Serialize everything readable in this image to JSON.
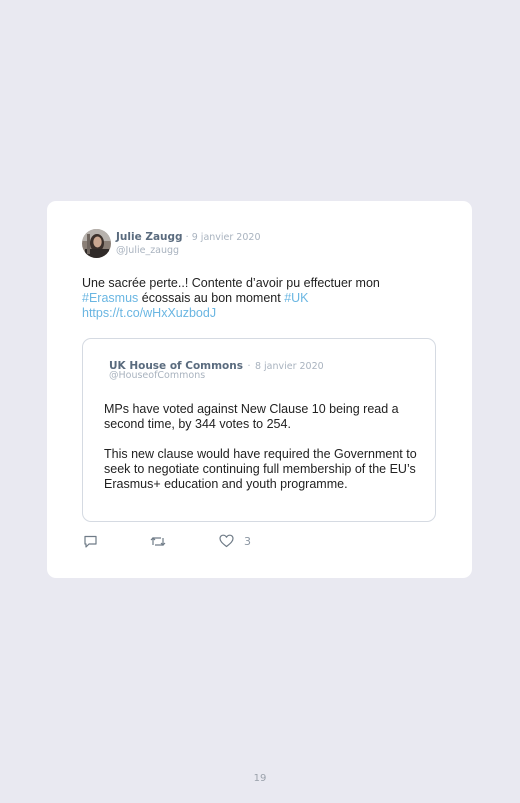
{
  "tweet": {
    "author_name": "Julie Zaugg",
    "separator": "·",
    "date": "9 janvier 2020",
    "handle": "@Julie_zaugg",
    "text_part1": "Une sacrée perte..! Contente d’avoir pu effectuer mon ",
    "hashtag1": "#Erasmus",
    "text_part2": " écossais au bon moment ",
    "hashtag2": "#UK",
    "url": "https://t.co/wHxXuzbodJ"
  },
  "quoted_tweet": {
    "author_name": "UK House of Commons",
    "separator": "·",
    "date": "8 janvier 2020",
    "handle": "@HouseofCommons",
    "paragraph1": "MPs have voted against New Clause 10 being read a second time, by 344 votes to 254.",
    "paragraph2": "This new clause would have required the Government to seek to negotiate continuing full membership of the EU’s Erasmus+ education and youth programme."
  },
  "actions": {
    "reply_icon": "reply-icon",
    "retweet_icon": "retweet-icon",
    "like_icon": "heart-icon",
    "like_count": "3"
  },
  "page": {
    "number": "19"
  },
  "colors": {
    "background": "#e9e9f1",
    "card": "#ffffff",
    "link": "#6ab6e2",
    "name": "#5a6b7e",
    "meta": "#a9b3bf"
  }
}
